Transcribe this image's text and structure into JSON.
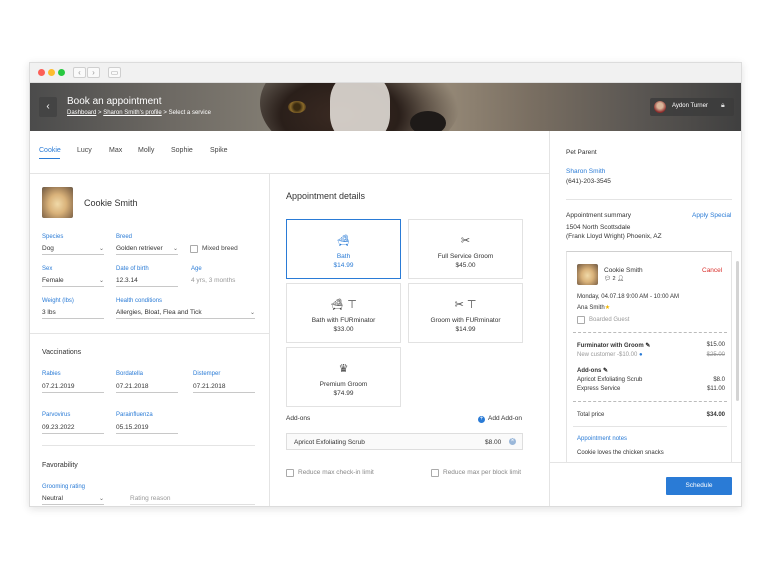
{
  "header": {
    "title": "Book an appointment",
    "breadcrumb": {
      "dashboard": "Dashboard",
      "sep1": ">",
      "profile": "Sharon Smith's profile",
      "sep2": ">",
      "current": "Select a service"
    },
    "user_name": "Aydon Turner",
    "back_icon": "chevron-left-icon"
  },
  "tabs": [
    "Cookie",
    "Lucy",
    "Max",
    "Molly",
    "Sophie",
    "Spike"
  ],
  "pet": {
    "name": "Cookie Smith",
    "species_label": "Species",
    "species": "Dog",
    "breed_label": "Breed",
    "breed": "Golden retriever",
    "mixed_breed_label": "Mixed breed",
    "sex_label": "Sex",
    "sex": "Female",
    "dob_label": "Date of birth",
    "dob": "12.3.14",
    "age_label": "Age",
    "age": "4 yrs, 3 months",
    "weight_label": "Weight (lbs)",
    "weight": "3 lbs",
    "health_label": "Health conditions",
    "health": "Allergies, Bloat, Flea and Tick"
  },
  "vaccinations": {
    "title": "Vaccinations",
    "items": [
      {
        "label": "Rabies",
        "value": "07.21.2019"
      },
      {
        "label": "Bordatella",
        "value": "07.21.2018"
      },
      {
        "label": "Distemper",
        "value": "07.21.2018"
      },
      {
        "label": "Parvovirus",
        "value": "09.23.2022"
      },
      {
        "label": "Parainfluenza",
        "value": "05.15.2019"
      }
    ]
  },
  "favorability": {
    "title": "Favorability",
    "rating_label": "Grooming rating",
    "rating_value": "Neutral",
    "reason_placeholder": "Rating reason"
  },
  "appointment": {
    "title": "Appointment details",
    "services": [
      {
        "name": "Bath",
        "price": "$14.99",
        "icon": "bathtub-icon",
        "selected": true
      },
      {
        "name": "Full Service Groom",
        "price": "$45.00",
        "icon": "scissors-icon",
        "selected": false
      },
      {
        "name": "Bath with FURminator",
        "price": "$33.00",
        "icon": "bath-brush-icon",
        "selected": false
      },
      {
        "name": "Groom with FURminator",
        "price": "$14.99",
        "icon": "scissors-brush-icon",
        "selected": false
      },
      {
        "name": "Premium Groom",
        "price": "$74.99",
        "icon": "crown-icon",
        "selected": false
      }
    ],
    "addons_label": "Add-ons",
    "add_addon_label": "Add Add-on",
    "addon_items": [
      {
        "name": "Apricot Exfoliating Scrub",
        "price": "$8.00"
      }
    ],
    "reduce_checkin": "Reduce max check-in limit",
    "reduce_block": "Reduce max per block limit"
  },
  "sidebar": {
    "pet_parent_label": "Pet Parent",
    "parent_name": "Sharon Smith",
    "parent_phone": "(641)-203-3545",
    "summary_label": "Appointment summary",
    "apply_special": "Apply Special",
    "address_line1": "1504 North Scottsdale",
    "address_line2": "(Frank Lloyd Wright) Phoenix, AZ",
    "card": {
      "pet_name": "Cookie Smith",
      "cancel": "Cancel",
      "datetime": "Monday, 04.07.18 9:00 AM - 10:00 AM",
      "groomer": "Ana Smith",
      "boarded_guest": "Boarded Guest",
      "service_name": "Furminator with Groom",
      "service_price": "$15.00",
      "discount_label": "New customer -$10.00",
      "discount_old_price": "$25.00",
      "addons_title": "Add-ons",
      "addons": [
        {
          "name": "Apricot Exfoliating Scrub",
          "price": "$8.0"
        },
        {
          "name": "Express Service",
          "price": "$11.00"
        }
      ],
      "total_label": "Total price",
      "total_value": "$34.00",
      "notes_label": "Appointment notes",
      "notes": "Cookie loves the chicken snacks"
    },
    "schedule_button": "Schedule"
  },
  "colors": {
    "accent": "#2a7bd6",
    "cancel": "#d9302c"
  }
}
